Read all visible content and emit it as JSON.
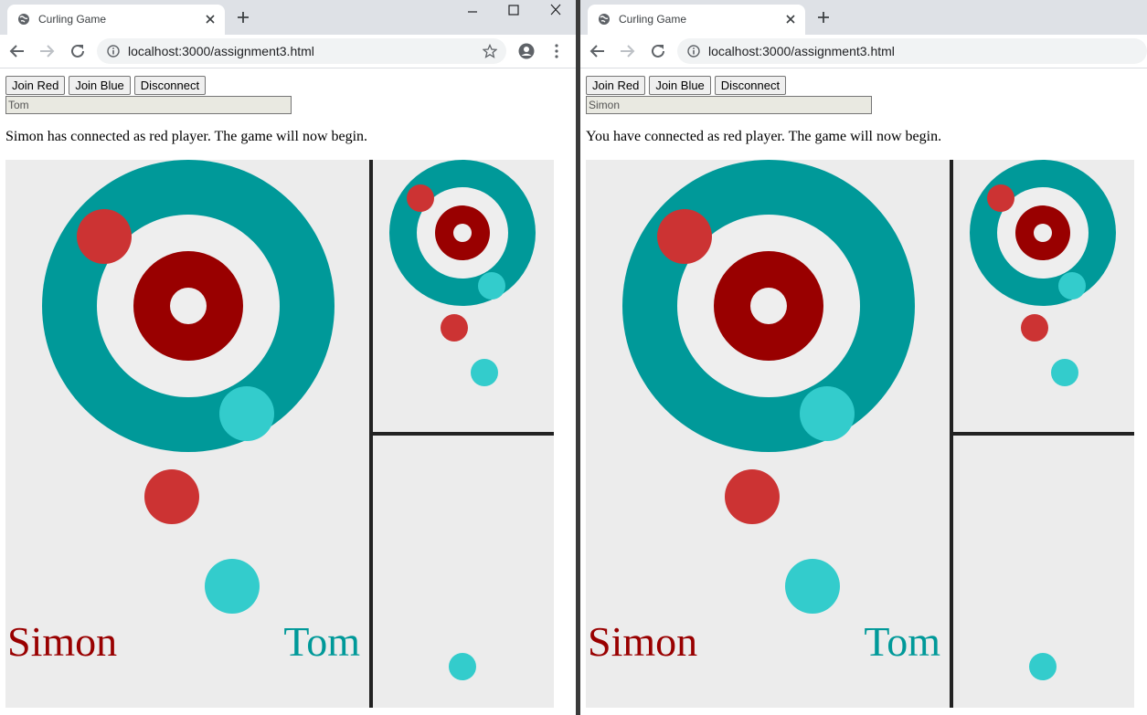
{
  "colors": {
    "ice": "#ececec",
    "outer_ring": "#009999",
    "middle_ring": "#eeeeee",
    "inner_ring": "#990000",
    "button": "#eeeeee",
    "red_stone": "#cc3333",
    "blue_stone": "#33cccc",
    "divider": "#222222",
    "red_player_name": "#990000",
    "blue_player_name": "#009999"
  },
  "windows": [
    {
      "tab_title": "Curling Game",
      "url": "localhost:3000/assignment3.html",
      "buttons": {
        "join_red": "Join Red",
        "join_blue": "Join Blue",
        "disconnect": "Disconnect"
      },
      "name_input": "Tom",
      "message": "Simon has connected as red player. The game will now begin.",
      "players": {
        "red": "Simon",
        "blue": "Tom"
      }
    },
    {
      "tab_title": "Curling Game",
      "url": "localhost:3000/assignment3.html",
      "buttons": {
        "join_red": "Join Red",
        "join_blue": "Join Blue",
        "disconnect": "Disconnect"
      },
      "name_input": "Simon",
      "message": "You have connected as red player. The game will now begin.",
      "players": {
        "red": "Simon",
        "blue": "Tom"
      }
    }
  ]
}
